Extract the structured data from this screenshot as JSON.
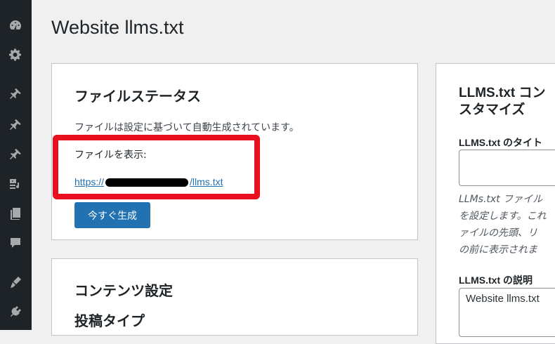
{
  "sidebar": {
    "icons": [
      "dashboard-icon",
      "settings-icon",
      "pin-icon",
      "pin-icon",
      "pin-icon",
      "media-icon",
      "pages-icon",
      "comments-icon",
      "appearance-icon",
      "plugins-icon"
    ]
  },
  "page": {
    "title": "Website llms.txt"
  },
  "status_card": {
    "title": "ファイルステータス",
    "description": "ファイルは設定に基づいて自動生成されています。",
    "view_label": "ファイルを表示:",
    "link_prefix": "https://",
    "link_suffix": "/llms.txt",
    "generate_button": "今すぐ生成"
  },
  "content_card": {
    "title": "コンテンツ設定",
    "subtitle": "投稿タイプ"
  },
  "custom_card": {
    "title_line1": "LLMS.txt コン",
    "title_line2": "スタマイズ",
    "title_field_label": "LLMS.txt のタイト",
    "help_line1": "LLMs.txt ファイル",
    "help_line2": "を設定します。これ",
    "help_line3": "ァイルの先頭、リ",
    "help_line4": "の前に表示されま",
    "description_label": "LLMS.txt の説明",
    "description_value": "Website llms.txt"
  },
  "colors": {
    "accent": "#2271b1",
    "highlight": "#e8101e",
    "sidebar": "#1d2327"
  }
}
